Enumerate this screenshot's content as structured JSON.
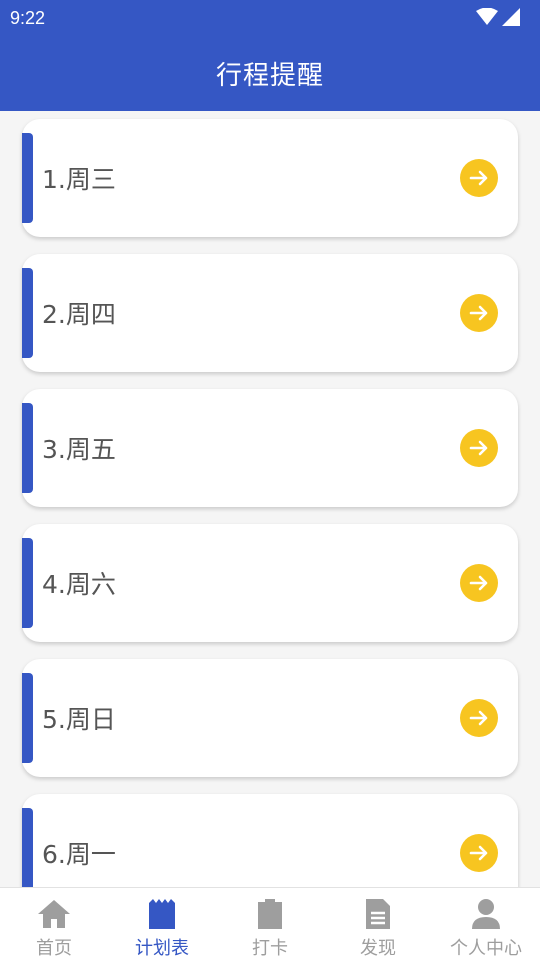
{
  "status_bar": {
    "time": "9:22"
  },
  "header": {
    "title": "行程提醒"
  },
  "colors": {
    "primary": "#3557c4",
    "accent_yellow": "#f7c520",
    "inactive_tab": "#9e9e9e"
  },
  "list": {
    "items": [
      {
        "label": "1.周三",
        "icon": "arrow-right-icon"
      },
      {
        "label": "2.周四",
        "icon": "arrow-right-icon"
      },
      {
        "label": "3.周五",
        "icon": "arrow-right-icon"
      },
      {
        "label": "4.周六",
        "icon": "arrow-right-icon"
      },
      {
        "label": "5.周日",
        "icon": "arrow-right-icon"
      },
      {
        "label": "6.周一",
        "icon": "arrow-right-icon"
      }
    ]
  },
  "tab_bar": {
    "active_index": 1,
    "tabs": [
      {
        "label": "首页",
        "icon": "home-icon"
      },
      {
        "label": "计划表",
        "icon": "planner-icon"
      },
      {
        "label": "打卡",
        "icon": "clipboard-icon"
      },
      {
        "label": "发现",
        "icon": "document-icon"
      },
      {
        "label": "个人中心",
        "icon": "person-icon"
      }
    ]
  }
}
